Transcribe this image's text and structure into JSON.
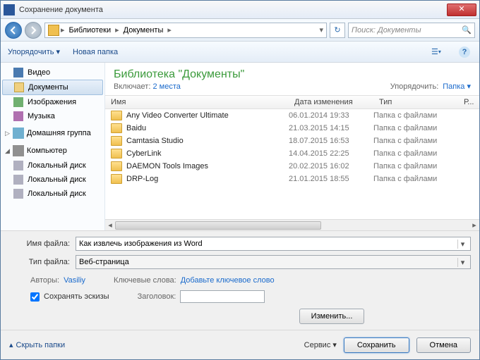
{
  "window": {
    "title": "Сохранение документа"
  },
  "nav": {
    "breadcrumb": [
      "Библиотеки",
      "Документы"
    ],
    "search_placeholder": "Поиск: Документы"
  },
  "toolbar": {
    "organize": "Упорядочить",
    "newfolder": "Новая папка"
  },
  "sidebar": {
    "libs": [
      {
        "key": "video",
        "label": "Видео"
      },
      {
        "key": "docs",
        "label": "Документы"
      },
      {
        "key": "images",
        "label": "Изображения"
      },
      {
        "key": "music",
        "label": "Музыка"
      }
    ],
    "homegroup": "Домашняя группа",
    "computer": "Компьютер",
    "disk": "Локальный диск"
  },
  "library": {
    "title": "Библиотека \"Документы\"",
    "includes_label": "Включает:",
    "includes_value": "2 места",
    "arrange_label": "Упорядочить:",
    "arrange_value": "Папка"
  },
  "columns": {
    "name": "Имя",
    "date": "Дата изменения",
    "type": "Тип",
    "size": "Р..."
  },
  "files": [
    {
      "name": "Any Video Converter Ultimate",
      "date": "06.01.2014 19:33",
      "type": "Папка с файлами"
    },
    {
      "name": "Baidu",
      "date": "21.03.2015 14:15",
      "type": "Папка с файлами"
    },
    {
      "name": "Camtasia Studio",
      "date": "18.07.2015 16:53",
      "type": "Папка с файлами"
    },
    {
      "name": "CyberLink",
      "date": "14.04.2015 22:25",
      "type": "Папка с файлами"
    },
    {
      "name": "DAEMON Tools Images",
      "date": "20.02.2015 16:02",
      "type": "Папка с файлами"
    },
    {
      "name": "DRP-Log",
      "date": "21.01.2015 18:55",
      "type": "Папка с файлами"
    }
  ],
  "fields": {
    "filename_label": "Имя файла:",
    "filename_value": "Как извлечь изображения из Word",
    "filetype_label": "Тип файла:",
    "filetype_value": "Веб-страница",
    "authors_label": "Авторы:",
    "authors_value": "Vasiliy",
    "keywords_label": "Ключевые слова:",
    "keywords_value": "Добавьте ключевое слово",
    "thumbs_label": "Сохранять эскизы",
    "title_label": "Заголовок:",
    "change_btn": "Изменить..."
  },
  "footer": {
    "hide": "Скрыть папки",
    "service": "Сервис",
    "save": "Сохранить",
    "cancel": "Отмена"
  }
}
